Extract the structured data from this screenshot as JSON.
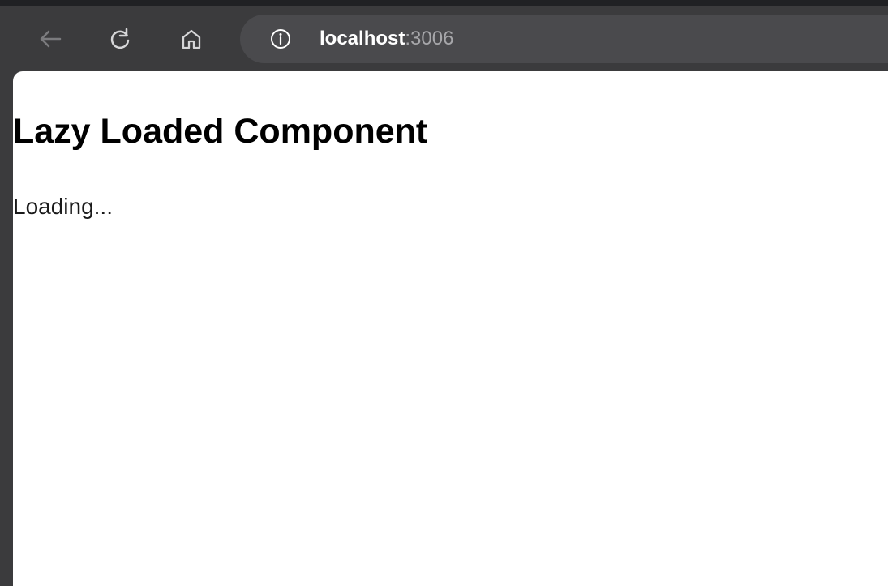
{
  "browser": {
    "url_host": "localhost",
    "url_port": ":3006",
    "icons": {
      "back": "arrow-left-icon",
      "reload": "reload-icon",
      "home": "home-icon",
      "info": "info-icon"
    }
  },
  "page": {
    "title": "Lazy Loaded Component",
    "status_text": "Loading..."
  },
  "colors": {
    "toolbar": "#3b3b3d",
    "omnibox": "#4a4a4d",
    "content": "#ffffff",
    "icon": "#d6d6d8",
    "disabled_icon": "#7b7b7e"
  }
}
